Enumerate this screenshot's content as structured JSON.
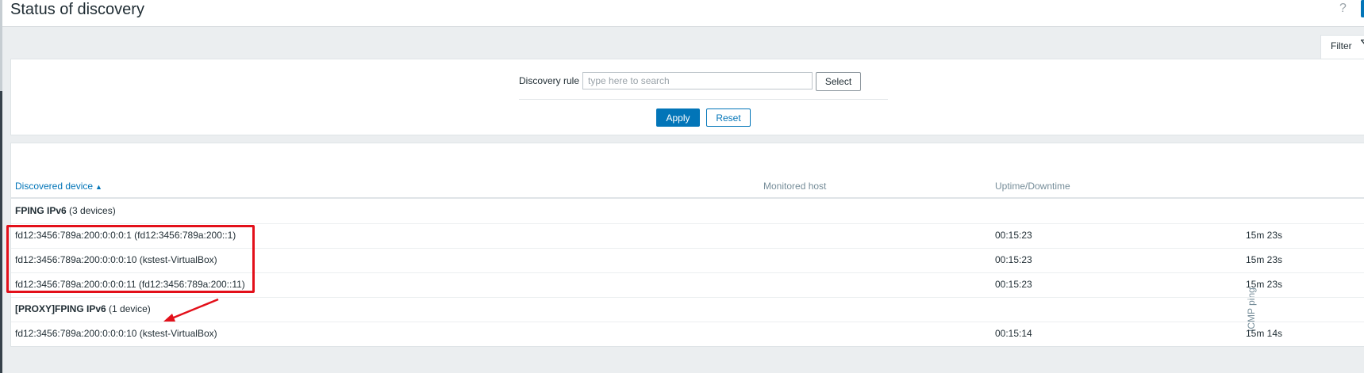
{
  "header": {
    "title": "Status of discovery",
    "help_glyph": "?"
  },
  "filter_tab": {
    "label": "Filter",
    "icon": "filter-icon"
  },
  "filter": {
    "rule_label": "Discovery rule",
    "rule_placeholder": "type here to search",
    "select_label": "Select",
    "apply_label": "Apply",
    "reset_label": "Reset"
  },
  "table": {
    "columns": {
      "discovered_device": "Discovered device",
      "monitored_host": "Monitored host",
      "uptime_downtime": "Uptime/Downtime",
      "icmp_ping": "ICMP ping"
    },
    "sort_indicator": "▲",
    "groups": [
      {
        "name": "FPING IPv6",
        "count": "(3 devices)",
        "rows": [
          {
            "device": "fd12:3456:789a:200:0:0:0:1 (fd12:3456:789a:200::1)",
            "monitored_host": "",
            "uptime": "00:15:23",
            "icmp": "15m 23s"
          },
          {
            "device": "fd12:3456:789a:200:0:0:0:10 (kstest-VirtualBox)",
            "monitored_host": "",
            "uptime": "00:15:23",
            "icmp": "15m 23s"
          },
          {
            "device": "fd12:3456:789a:200:0:0:0:11 (fd12:3456:789a:200::11)",
            "monitored_host": "",
            "uptime": "00:15:23",
            "icmp": "15m 23s"
          }
        ]
      },
      {
        "name": "[PROXY]FPING IPv6",
        "count": "(1 device)",
        "rows": [
          {
            "device": "fd12:3456:789a:200:0:0:0:10 (kstest-VirtualBox)",
            "monitored_host": "",
            "uptime": "00:15:14",
            "icmp": "15m 14s"
          }
        ]
      }
    ]
  },
  "colors": {
    "accent": "#0275b8",
    "annotation": "#e3101a",
    "background": "#ebeef0"
  }
}
